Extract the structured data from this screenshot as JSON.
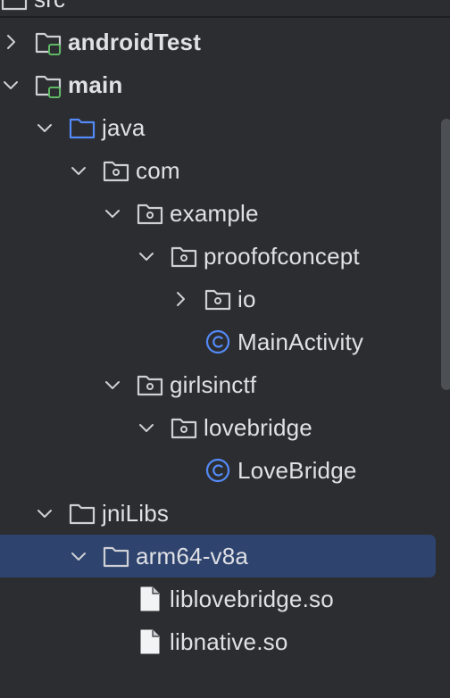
{
  "project_tree": {
    "items": [
      {
        "label": "src",
        "icon": "module-folder-icon",
        "chevron": "none",
        "bold": false
      },
      {
        "label": "androidTest",
        "icon": "test-source-folder-icon",
        "chevron": "collapsed",
        "bold": true
      },
      {
        "label": "main",
        "icon": "source-set-folder-icon",
        "chevron": "expanded",
        "bold": true
      },
      {
        "label": "java",
        "icon": "source-root-folder-icon",
        "chevron": "expanded",
        "bold": false
      },
      {
        "label": "com",
        "icon": "package-icon",
        "chevron": "expanded",
        "bold": false
      },
      {
        "label": "example",
        "icon": "package-icon",
        "chevron": "expanded",
        "bold": false
      },
      {
        "label": "proofofconcept",
        "icon": "package-icon",
        "chevron": "expanded",
        "bold": false
      },
      {
        "label": "io",
        "icon": "package-icon",
        "chevron": "collapsed",
        "bold": false
      },
      {
        "label": "MainActivity",
        "icon": "class-icon",
        "chevron": "none",
        "bold": false
      },
      {
        "label": "girlsinctf",
        "icon": "package-icon",
        "chevron": "expanded",
        "bold": false
      },
      {
        "label": "lovebridge",
        "icon": "package-icon",
        "chevron": "expanded",
        "bold": false
      },
      {
        "label": "LoveBridge",
        "icon": "class-icon",
        "chevron": "none",
        "bold": false
      },
      {
        "label": "jniLibs",
        "icon": "folder-icon",
        "chevron": "expanded",
        "bold": false
      },
      {
        "label": "arm64-v8a",
        "icon": "folder-icon",
        "chevron": "expanded",
        "bold": false,
        "selected": true
      },
      {
        "label": "liblovebridge.so",
        "icon": "file-icon",
        "chevron": "none",
        "bold": false
      },
      {
        "label": "libnative.so",
        "icon": "file-icon",
        "chevron": "none",
        "bold": false
      }
    ]
  },
  "colors": {
    "background": "#2b2d30",
    "text": "#dfe1e5",
    "selection": "#2e436e",
    "icon_stroke": "#ced0d6",
    "source_root_blue": "#548af7",
    "test_green": "#5fb865",
    "class_blue": "#548af7",
    "scrollbar": "#4c4f54"
  }
}
